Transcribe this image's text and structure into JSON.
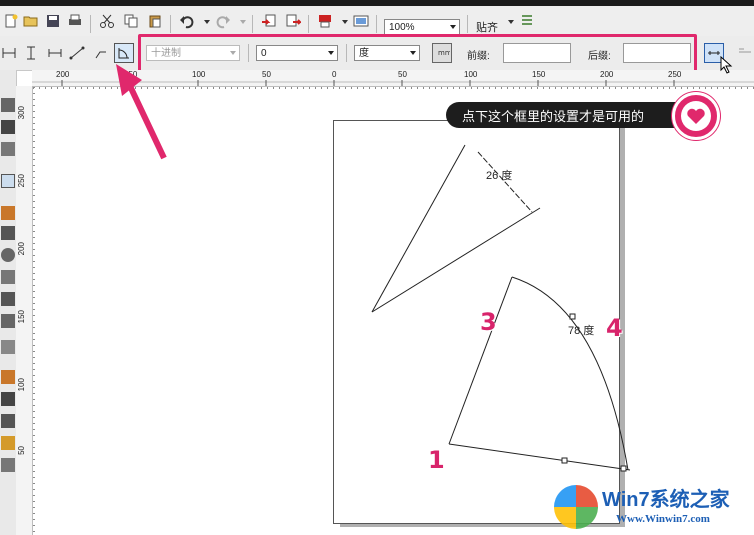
{
  "toolbar": {
    "zoom_value": "100%",
    "snap_label": "贴齐"
  },
  "property_bar": {
    "number_format": "十进制",
    "precision": "0",
    "unit": "度",
    "prefix_label": "前缀:",
    "prefix_value": "",
    "suffix_label": "后缀:",
    "suffix_value": "",
    "dynamic_tooltip": "动态"
  },
  "ruler": {
    "h_labels": [
      "200",
      "150",
      "100",
      "50",
      "0",
      "50",
      "100",
      "150",
      "200",
      "250"
    ],
    "v_labels": [
      "300",
      "250",
      "200",
      "150",
      "100",
      "50"
    ]
  },
  "annotation": {
    "tooltip_text": "点下这个框里的设置才是可用的",
    "highlight_color": "#e0286c"
  },
  "drawing": {
    "angle_top": "26 度",
    "angle_right": "78 度",
    "step_labels": [
      "1",
      "3",
      "4"
    ]
  },
  "watermark": {
    "title": "Win7系统之家",
    "url": "Www.Winwin7.com"
  }
}
